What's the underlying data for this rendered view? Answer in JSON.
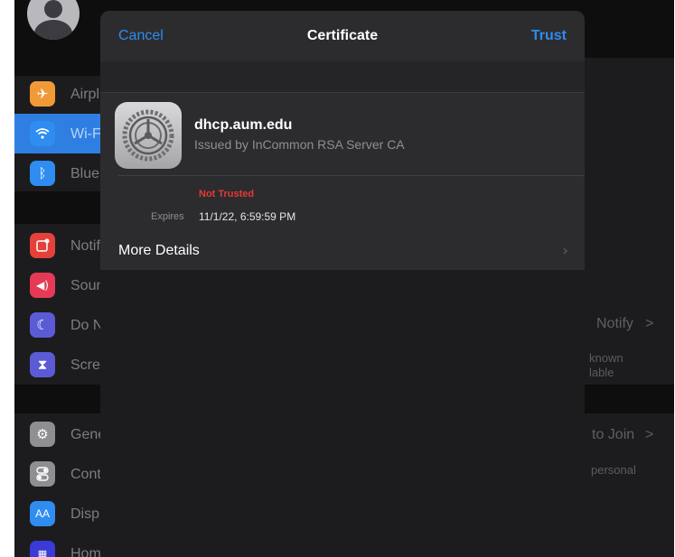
{
  "background": {
    "sidebar": {
      "items": [
        {
          "label": "Airpl",
          "icon": "airplane-icon",
          "color": "#f09a37"
        },
        {
          "label": "Wi-F",
          "icon": "wifi-icon",
          "color": "#2f8cf0"
        },
        {
          "label": "Blue",
          "icon": "bluetooth-icon",
          "color": "#2f8cf0"
        },
        {
          "label": "Notifi",
          "icon": "notifications-icon",
          "color": "#e5403a"
        },
        {
          "label": "Soun",
          "icon": "sound-icon",
          "color": "#e53a55"
        },
        {
          "label": "Do N",
          "icon": "moon-icon",
          "color": "#5b5bd6"
        },
        {
          "label": "Scre",
          "icon": "hourglass-icon",
          "color": "#5b5bd6"
        },
        {
          "label": "Gene",
          "icon": "gear-icon",
          "color": "#8e8e93"
        },
        {
          "label": "Cont",
          "icon": "toggles-icon",
          "color": "#8e8e93"
        },
        {
          "label": "Disp",
          "icon": "text-size-icon",
          "color": "#2f8cf0",
          "glyph": "AA"
        },
        {
          "label": "Hom",
          "icon": "home-grid-icon",
          "color": "#3a3ad6"
        }
      ]
    },
    "right_texts": {
      "notify": "Notify",
      "notify_chevron": ">",
      "known_1": "known",
      "known_2": "lable",
      "to_join": "to Join",
      "to_join_chevron": ">",
      "personal": "personal"
    }
  },
  "sheet": {
    "nav": {
      "cancel": "Cancel",
      "title": "Certificate",
      "trust": "Trust"
    },
    "certificate": {
      "icon": "gear-icon",
      "name": "dhcp.aum.edu",
      "issuer": "Issued by InCommon RSA Server CA",
      "status": "Not Trusted",
      "expires_label": "Expires",
      "expires_value": "11/1/22, 6:59:59 PM",
      "more_details": "More Details"
    }
  },
  "colors": {
    "accent": "#2f8cf0",
    "danger": "#e53935"
  }
}
